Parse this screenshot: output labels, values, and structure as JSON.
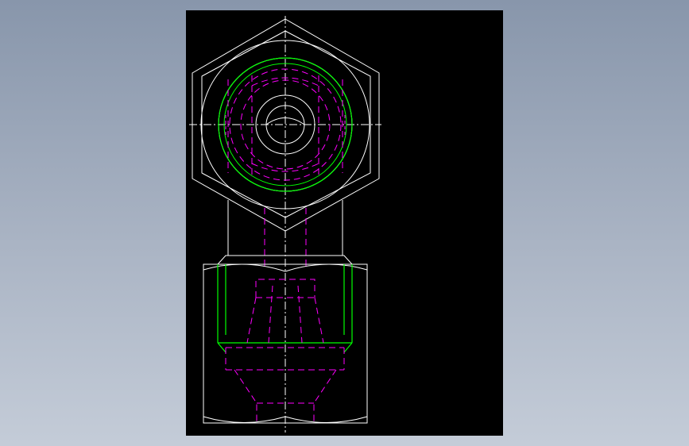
{
  "viewport": {
    "background_top": "#8896ab",
    "background_bottom": "#c4ccd8"
  },
  "sheet": {
    "background": "#000000"
  },
  "colors": {
    "outline": "#ffffff",
    "hidden": "#ff00ff",
    "thread": "#00ff00",
    "centerline": "#ffffff"
  }
}
